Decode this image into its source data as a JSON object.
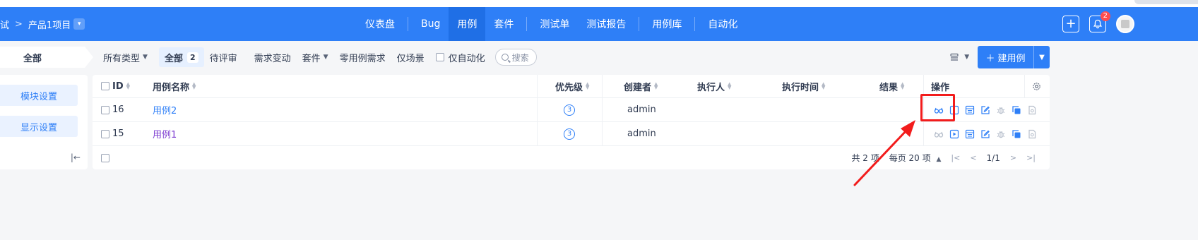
{
  "header": {
    "breadcrumb_prefix": "试",
    "breadcrumb_sep": ">",
    "project": "产品1项目",
    "nav": [
      {
        "label": "仪表盘",
        "active": false
      },
      {
        "label": "Bug",
        "active": false
      },
      {
        "label": "用例",
        "active": true
      },
      {
        "label": "套件",
        "active": false
      },
      {
        "label": "测试单",
        "active": false
      },
      {
        "label": "测试报告",
        "active": false
      },
      {
        "label": "用例库",
        "active": false
      },
      {
        "label": "自动化",
        "active": false
      }
    ],
    "add_icon": "plus-icon",
    "bell_icon": "bell-icon",
    "notification_count": "2",
    "avatar_icon": "avatar"
  },
  "filterbar": {
    "module": "全部",
    "type": "所有类型",
    "tab_all": "全部",
    "tab_all_count": "2",
    "tabs": [
      "待评审",
      "需求变动",
      "套件",
      "零用例需求",
      "仅场景"
    ],
    "auto_only": "仅自动化",
    "search_placeholder": "搜索",
    "create_label": "建用例"
  },
  "sidebar": {
    "module_settings": "模块设置",
    "display_settings": "显示设置",
    "collapse": "|←"
  },
  "table": {
    "headers": {
      "id": "ID",
      "name": "用例名称",
      "priority": "优先级",
      "creator": "创建者",
      "executor": "执行人",
      "exec_time": "执行时间",
      "result": "结果",
      "actions": "操作"
    },
    "rows": [
      {
        "id": "16",
        "name": "用例2",
        "priority": "3",
        "creator": "admin"
      },
      {
        "id": "15",
        "name": "用例1",
        "priority": "3",
        "creator": "admin"
      }
    ],
    "footer": {
      "total": "共 2 项",
      "per_page": "每页 20 项",
      "page": "1/1"
    }
  },
  "annotation": {
    "color": "#f21c1c"
  }
}
